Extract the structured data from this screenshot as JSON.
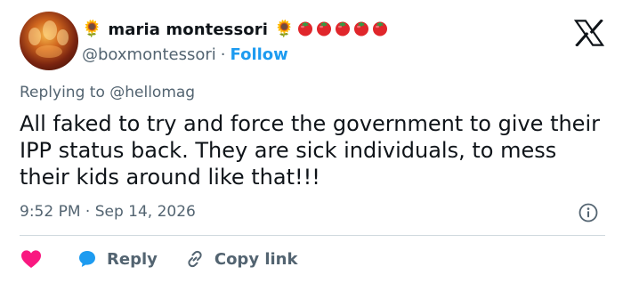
{
  "author": {
    "name": "maria montessori",
    "emoji_before": "🌻",
    "emoji_after": "🌻",
    "tomato_count": 5,
    "handle": "@boxmontessori",
    "separator": "·",
    "follow_label": "Follow"
  },
  "reply": {
    "prefix": "Replying to",
    "mention": "@hellomag"
  },
  "tweet": {
    "text": "All faked to try and force the government to give their IPP status back. They are sick individuals, to mess their kids around like that!!!",
    "timestamp": "9:52 PM · Sep 14, 2026"
  },
  "actions": {
    "reply_label": "Reply",
    "copy_link_label": "Copy link"
  },
  "icons": {
    "logo": "x-logo-icon",
    "info": "info-icon",
    "like": "heart-icon",
    "reply": "reply-bubble-icon",
    "copy": "link-icon"
  },
  "colors": {
    "accent": "#1d9bf0",
    "heart": "#f91880",
    "muted": "#536471",
    "text": "#0f1419",
    "tomato": "#e0262b"
  }
}
